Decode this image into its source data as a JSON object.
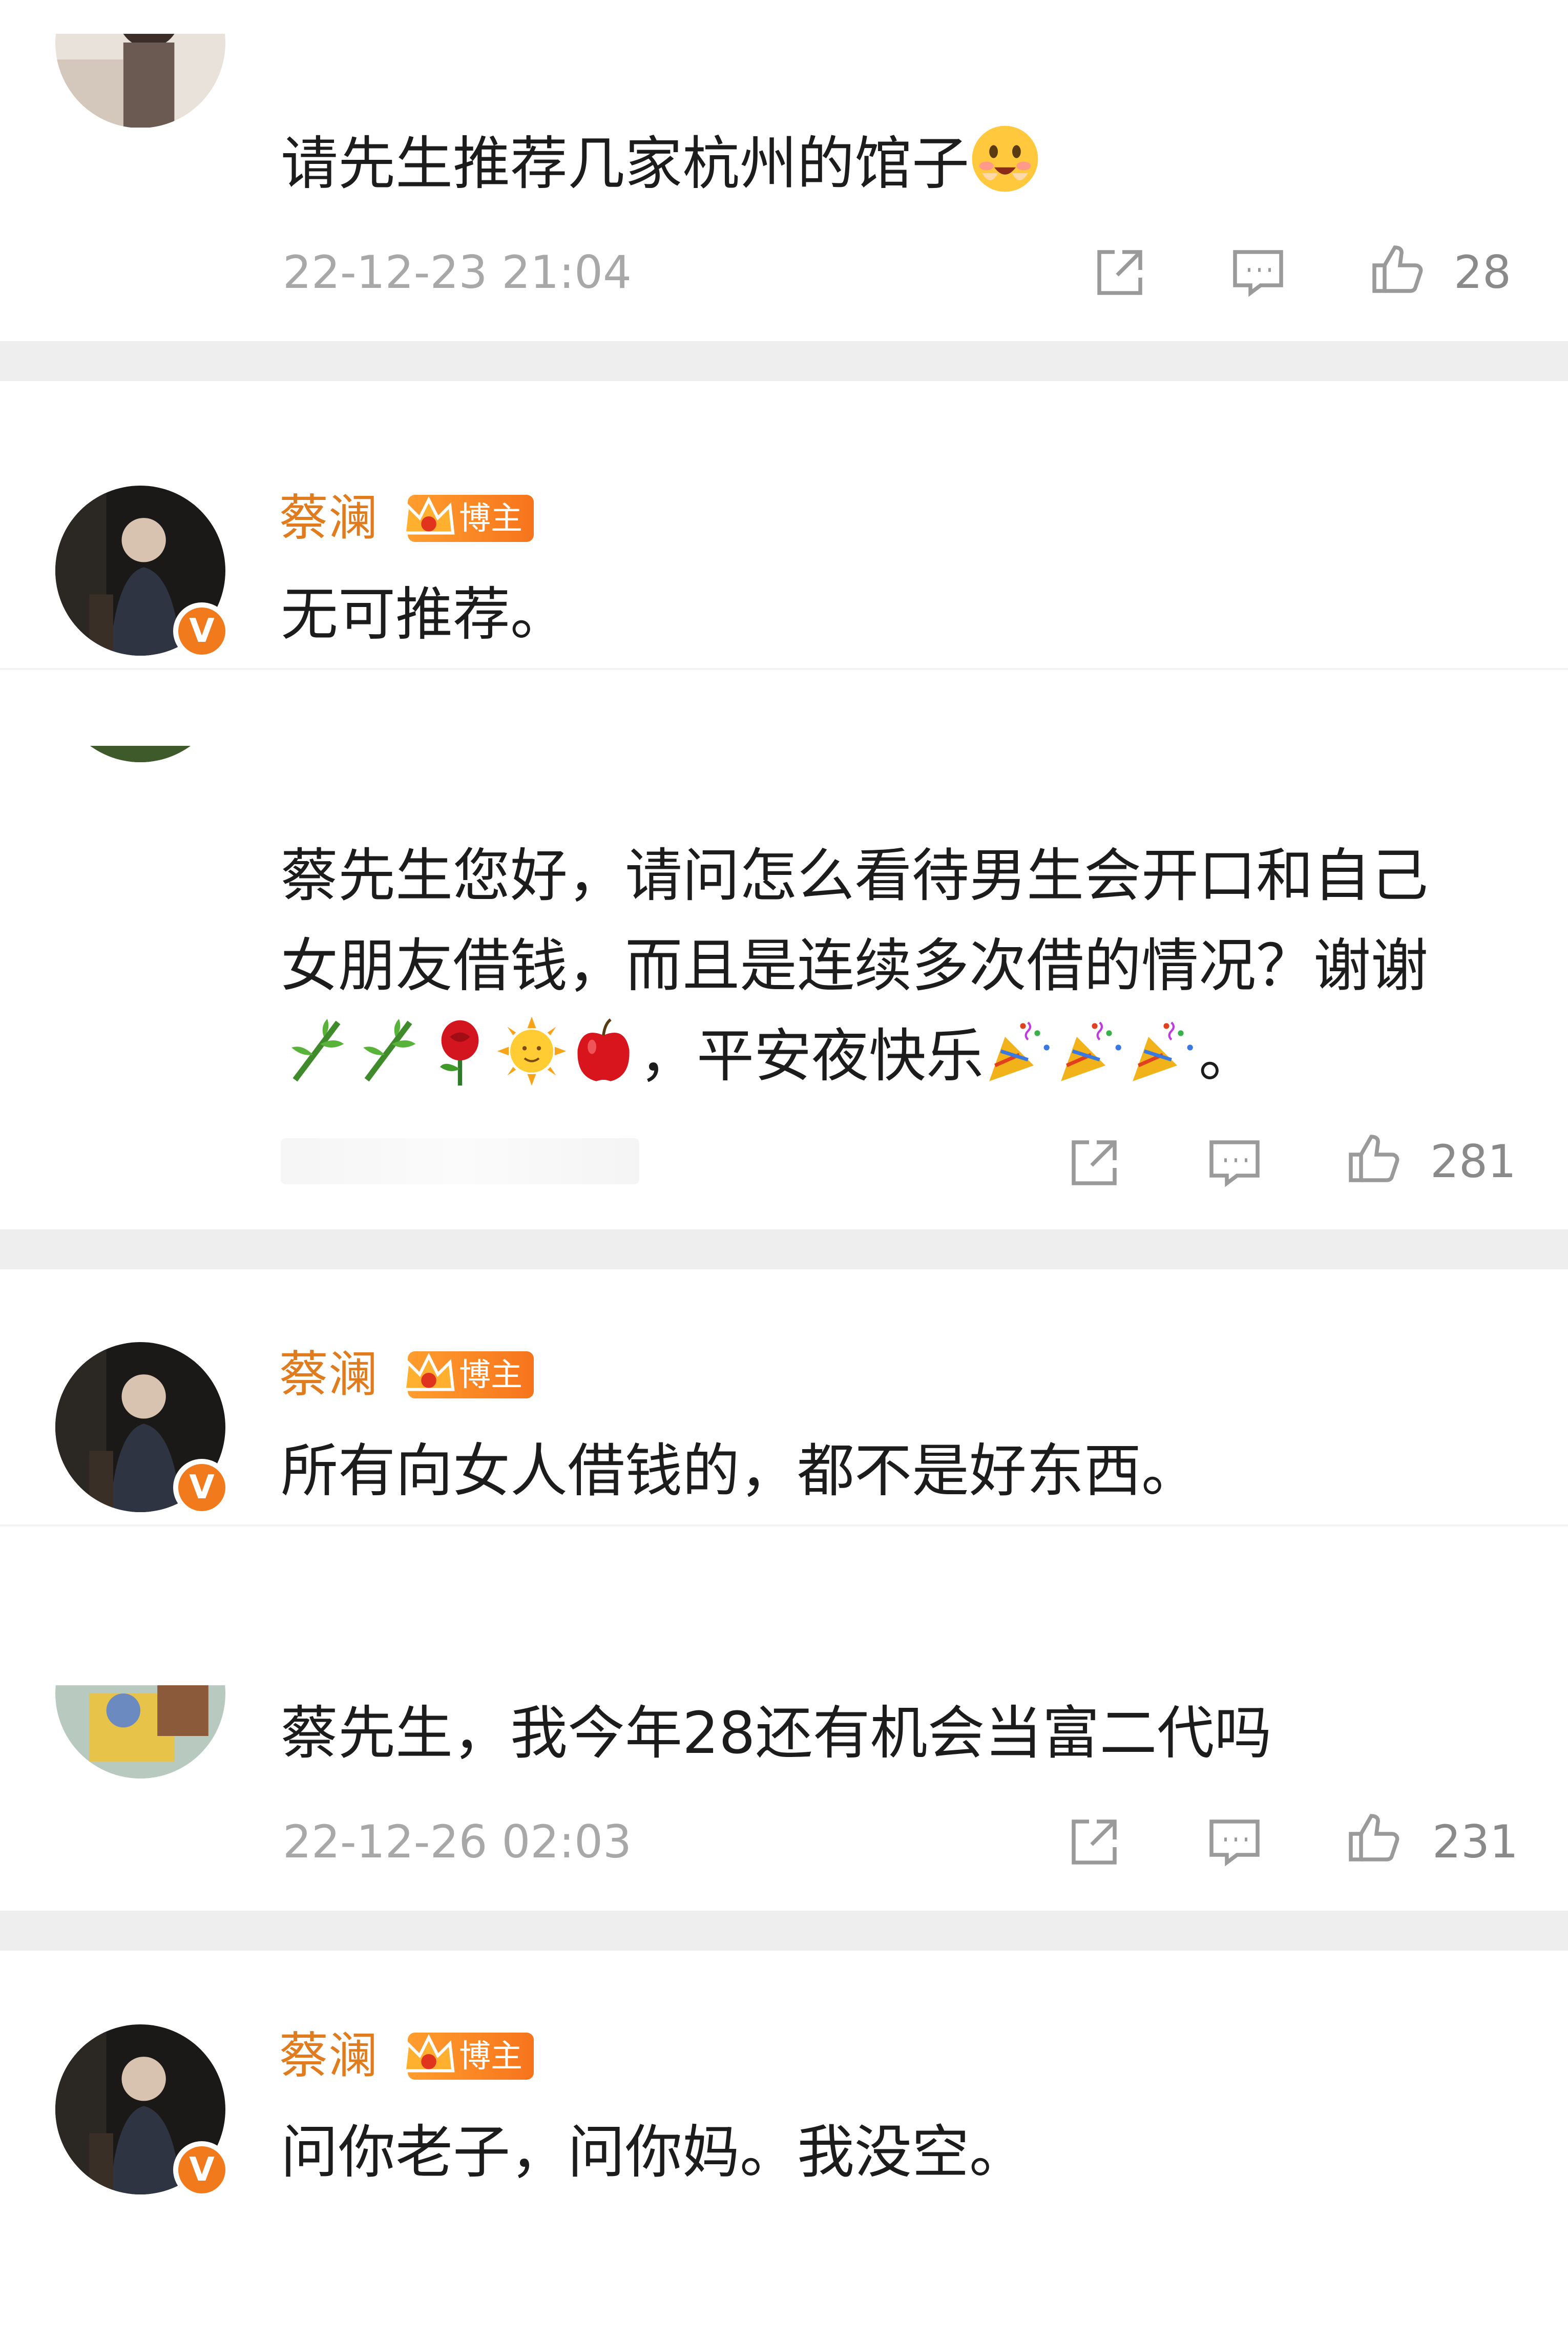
{
  "comments": [
    {
      "text": "请先生推荐几家杭州的馆子",
      "time": "22-12-23 21:04",
      "likes": "28"
    },
    {
      "author": "蔡澜",
      "tag": "博主",
      "verified": "V",
      "text": "无可推荐。"
    },
    {
      "text_lines": [
        "蔡先生您好，请问怎么看待男生会开口和自己",
        "女朋友借钱，而且是连续多次借的情况？谢谢"
      ],
      "line3_text": "，平安夜快乐",
      "line3_end": "。",
      "likes": "281"
    },
    {
      "author": "蔡澜",
      "tag": "博主",
      "verified": "V",
      "text": "所有向女人借钱的，都不是好东西。"
    },
    {
      "text": "蔡先生，我今年28还有机会当富二代吗",
      "time": "22-12-26 02:03",
      "likes": "231"
    },
    {
      "author": "蔡澜",
      "tag": "博主",
      "verified": "V",
      "text": "问你老子，问你妈。我没空。"
    }
  ],
  "colors": {
    "author": "#e07c1e",
    "badge": "#f07a1c",
    "meta": "#a8a8a8",
    "divider": "#eeeeee"
  },
  "icons": [
    "share-icon",
    "comment-icon",
    "like-icon",
    "smiling-emoji-icon",
    "bamboo-emoji-icon",
    "rose-emoji-icon",
    "sun-emoji-icon",
    "apple-emoji-icon",
    "party-popper-emoji-icon",
    "crown-icon"
  ]
}
